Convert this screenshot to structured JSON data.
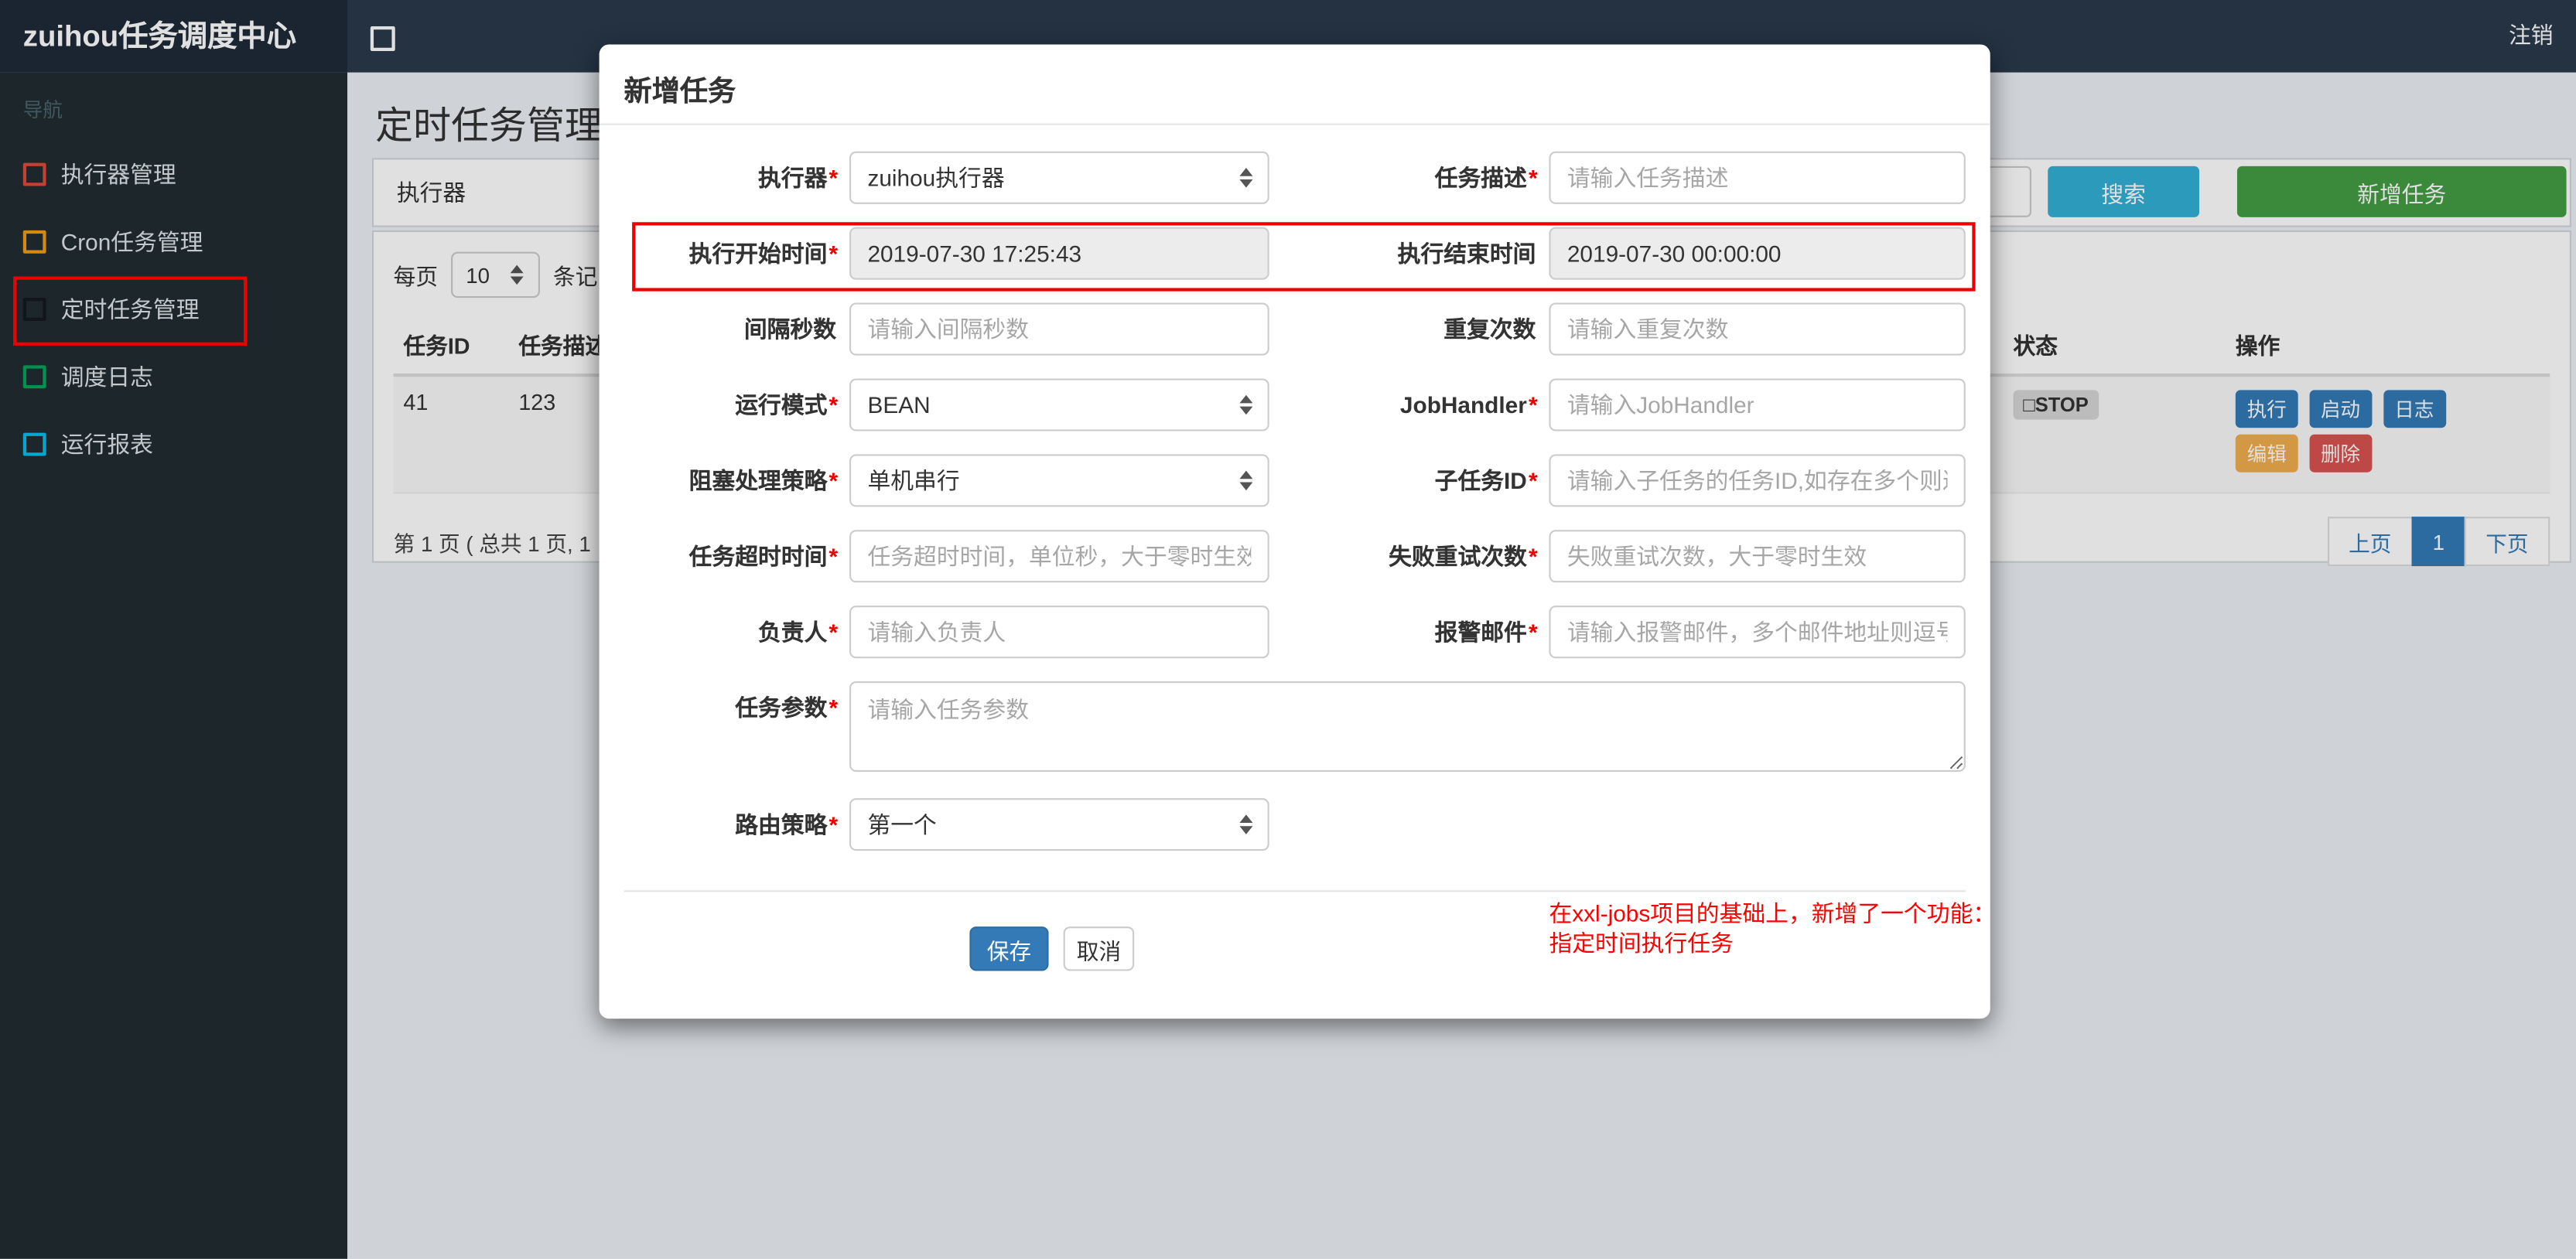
{
  "navbar": {
    "brand": "zuihou任务调度中心",
    "logout": "注销"
  },
  "sidebar": {
    "header": "导航",
    "items": [
      {
        "label": "执行器管理",
        "icon_color": "#dd4b39"
      },
      {
        "label": "Cron任务管理",
        "icon_color": "#f39c12"
      },
      {
        "label": "定时任务管理",
        "icon_color": "#15191d",
        "annotated": true
      },
      {
        "label": "调度日志",
        "icon_color": "#00a65a"
      },
      {
        "label": "运行报表",
        "icon_color": "#00c0ef"
      }
    ]
  },
  "main": {
    "page_title": "定时任务管理",
    "filter": {
      "executor_label": "执行器",
      "search": "搜索",
      "add": "新增任务"
    },
    "perpage": {
      "prefix": "每页",
      "value": "10",
      "suffix": "条记"
    },
    "table": {
      "col_task_id": "任务ID",
      "col_desc": "任务描述",
      "col_status": "状态",
      "col_actions": "操作",
      "row": {
        "task_id": "41",
        "desc": "123",
        "status_icon": "□",
        "status": "STOP",
        "act_run": "执行",
        "act_start": "启动",
        "act_log": "日志",
        "act_edit": "编辑",
        "act_delete": "删除"
      }
    },
    "pagination": {
      "summary": "第 1 页 ( 总共 1 页, 1",
      "prev": "上页",
      "current": "1",
      "next": "下页"
    }
  },
  "modal": {
    "title": "新增任务",
    "fields": {
      "executor": {
        "label": "执行器",
        "star": "*",
        "value": "zuihou执行器"
      },
      "job_desc": {
        "label": "任务描述",
        "star": "*",
        "placeholder": "请输入任务描述"
      },
      "start_time": {
        "label": "执行开始时间",
        "star": "*",
        "value": "2019-07-30 17:25:43"
      },
      "end_time": {
        "label": "执行结束时间",
        "star": "",
        "value": "2019-07-30 00:00:00"
      },
      "interval": {
        "label": "间隔秒数",
        "star": "",
        "placeholder": "请输入间隔秒数"
      },
      "repeat_count": {
        "label": "重复次数",
        "star": "",
        "placeholder": "请输入重复次数"
      },
      "run_mode": {
        "label": "运行模式",
        "star": "*",
        "value": "BEAN"
      },
      "job_handler": {
        "label": "JobHandler",
        "star": "*",
        "placeholder": "请输入JobHandler"
      },
      "block_strategy": {
        "label": "阻塞处理策略",
        "star": "*",
        "value": "单机串行"
      },
      "child_job_id": {
        "label": "子任务ID",
        "star": "*",
        "placeholder": "请输入子任务的任务ID,如存在多个则逗"
      },
      "timeout": {
        "label": "任务超时时间",
        "star": "*",
        "placeholder": "任务超时时间，单位秒，大于零时生效"
      },
      "fail_retry": {
        "label": "失败重试次数",
        "star": "*",
        "placeholder": "失败重试次数，大于零时生效"
      },
      "owner": {
        "label": "负责人",
        "star": "*",
        "placeholder": "请输入负责人"
      },
      "alarm_email": {
        "label": "报警邮件",
        "star": "*",
        "placeholder": "请输入报警邮件，多个邮件地址则逗号分"
      },
      "job_param": {
        "label": "任务参数",
        "star": "*",
        "placeholder": "请输入任务参数"
      },
      "route_strategy": {
        "label": "路由策略",
        "star": "*",
        "value": "第一个"
      }
    },
    "note_line1": "在xxl-jobs项目的基础上，新增了一个功能：",
    "note_line2": "指定时间执行任务",
    "save": "保存",
    "cancel": "取消"
  },
  "colors": {
    "navbar_bg": "#2a3a4c",
    "brand_bg": "#1f2b38",
    "sidebar_bg": "#222d32",
    "primary": "#337ab7",
    "success": "#449d44",
    "info": "#31b0d5",
    "warning": "#f0ad4e",
    "danger": "#d9534f",
    "annotation_red": "#ee0000"
  }
}
